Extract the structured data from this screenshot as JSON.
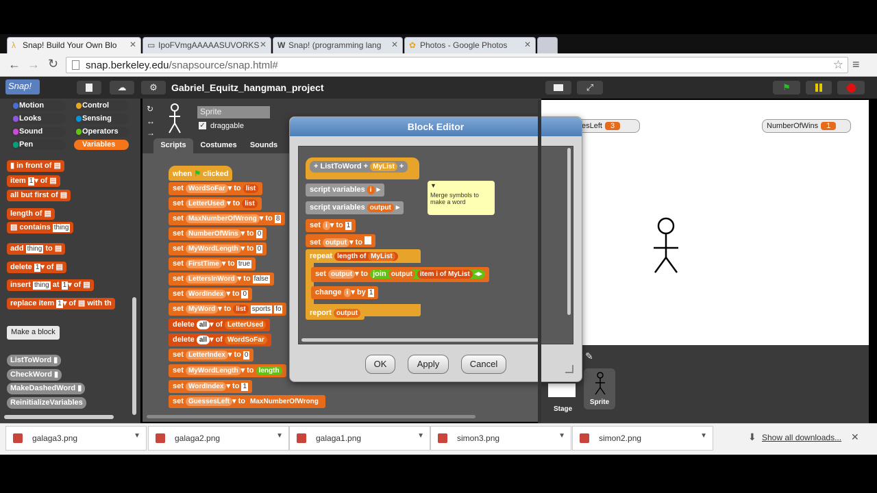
{
  "browser": {
    "tabs": [
      {
        "label": "Snap! Build Your Own Blo",
        "icon": "snap-lambda-icon"
      },
      {
        "label": "IpoFVmgAAAAASUVORKS",
        "icon": "page-icon"
      },
      {
        "label": "Snap! (programming lang",
        "icon": "wikipedia-icon"
      },
      {
        "label": "Photos - Google Photos",
        "icon": "google-photos-icon"
      }
    ],
    "url_host": "snap.berkeley.edu",
    "url_path": "/snapsource/snap.html#"
  },
  "snap": {
    "logo": "Snap!",
    "project_name": "Gabriel_Equitz_hangman_project",
    "categories": [
      "Motion",
      "Control",
      "Looks",
      "Sensing",
      "Sound",
      "Operators",
      "Pen",
      "Variables"
    ],
    "category_colors": {
      "Motion": "#4a6cd4",
      "Control": "#e6a822",
      "Looks": "#8f56e3",
      "Sensing": "#0494dc",
      "Sound": "#cf4ad9",
      "Operators": "#62c213",
      "Pen": "#00a178",
      "Variables": "#f3761d"
    },
    "sprite": {
      "name": "Sprite",
      "draggable_label": "draggable"
    },
    "tabs": [
      "Scripts",
      "Costumes",
      "Sounds"
    ],
    "palette": {
      "list_blocks": [
        "in front of",
        "item",
        "of",
        "all but first of",
        "length of",
        "contains",
        "thing",
        "add",
        "to",
        "delete",
        "insert",
        "at",
        "replace item",
        "with",
        "th"
      ],
      "make_block": "Make a block",
      "custom_blocks": [
        "ListToWord",
        "CheckWord",
        "MakeDashedWord",
        "ReinitializeVariables"
      ],
      "slot_one": "1"
    },
    "scripts": {
      "hat": {
        "when": "when",
        "clicked": "clicked"
      },
      "lines": [
        {
          "cmd": "set",
          "var": "WordSoFar",
          "to": "to",
          "val": "list"
        },
        {
          "cmd": "set",
          "var": "LetterUsed",
          "to": "to",
          "val": "list"
        },
        {
          "cmd": "set",
          "var": "MaxNumberOfWrong",
          "to": "to",
          "val": "8"
        },
        {
          "cmd": "set",
          "var": "NumberOfWins",
          "to": "to",
          "val": "0"
        },
        {
          "cmd": "set",
          "var": "MyWordLength",
          "to": "to",
          "val": "0"
        },
        {
          "cmd": "set",
          "var": "FirstTime",
          "to": "to",
          "val": "true"
        },
        {
          "cmd": "set",
          "var": "LettersInWord",
          "to": "to",
          "val": "false"
        },
        {
          "cmd": "set",
          "var": "WordIndex",
          "to": "to",
          "val": "0"
        },
        {
          "cmd": "set",
          "var": "MyWord",
          "to": "to",
          "val": "list",
          "extra": "sports",
          "extra2": "fo"
        },
        {
          "cmd": "delete",
          "var": "all",
          "to": "of",
          "val": "LetterUsed"
        },
        {
          "cmd": "delete",
          "var": "all",
          "to": "of",
          "val": "WordSoFar"
        },
        {
          "cmd": "set",
          "var": "LetterIndex",
          "to": "to",
          "val": "0"
        },
        {
          "cmd": "set",
          "var": "MyWordLength",
          "to": "to",
          "val": "length"
        },
        {
          "cmd": "set",
          "var": "WordIndex",
          "to": "to",
          "val": "1"
        },
        {
          "cmd": "set",
          "var": "GuessesLeft",
          "to": "to",
          "val": "MaxNumberOfWrong"
        }
      ]
    },
    "stage": {
      "watchers": [
        {
          "label": "esLeft",
          "value": "3"
        },
        {
          "label": "NumberOfWins",
          "value": "1"
        }
      ]
    },
    "corral": {
      "stage_label": "Stage",
      "sprite_label": "Sprite"
    }
  },
  "block_editor": {
    "title": "Block Editor",
    "prototype": {
      "name": "ListToWord",
      "param": "MyList"
    },
    "comment": "Merge symbols to make a word",
    "lines": {
      "script_variables": "script variables",
      "var_i": "i",
      "var_output": "output",
      "set": "set",
      "to": "to",
      "val_one": "1",
      "repeat": "repeat",
      "length_of": "length of",
      "mylist": "MyList",
      "join": "join",
      "item": "item",
      "of": "of",
      "change": "change",
      "by": "by",
      "report": "report"
    },
    "buttons": {
      "ok": "OK",
      "apply": "Apply",
      "cancel": "Cancel"
    }
  },
  "downloads": {
    "items": [
      "galaga3.png",
      "galaga2.png",
      "galaga1.png",
      "simon3.png",
      "simon2.png"
    ],
    "show_all": "Show all downloads..."
  }
}
